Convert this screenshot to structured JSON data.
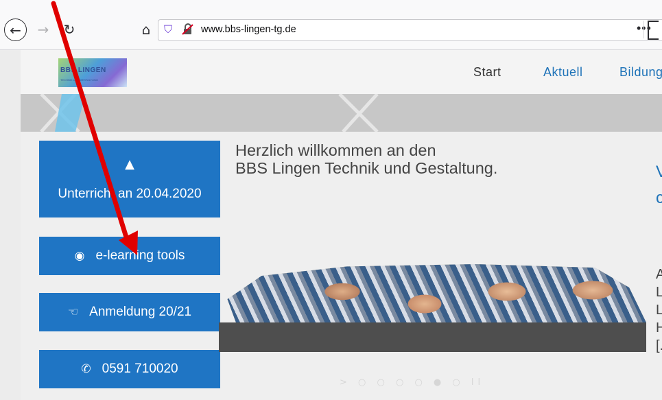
{
  "browser": {
    "url_host": "www.bbs-lingen-tg.de",
    "url_more": "•••",
    "icons": {
      "back": "back-arrow-icon",
      "forward": "forward-arrow-icon",
      "reload": "reload-icon",
      "home": "home-icon",
      "shield": "tracking-shield-icon",
      "lock": "insecure-lock-icon"
    }
  },
  "site": {
    "logo_text": "BBS LINGEN",
    "logo_sub": "TECHNIK UND GESTALTUNG",
    "nav": {
      "start": "Start",
      "aktuell": "Aktuell",
      "bildung": "Bildungs"
    },
    "sidebar": {
      "unterricht": "Unterricht an 20.04.2020",
      "elearning": "e-learning tools",
      "anmeldung": "Anmeldung 20/21",
      "phone": "0591 710020"
    },
    "welcome": {
      "line1": "Herzlich willkommen an den",
      "line2": "BBS Lingen Technik und Gestaltung."
    },
    "right_partial": {
      "heading1": "V",
      "heading2": "c",
      "lines": [
        "A",
        "L",
        "L",
        "H",
        "[."
      ]
    },
    "slider_indicators": "> ○ ○ ○ ○ ● ○ ll"
  },
  "colors": {
    "accent": "#1f75c4",
    "nav_link": "#1d72b8",
    "annotation_arrow": "#e00000"
  }
}
